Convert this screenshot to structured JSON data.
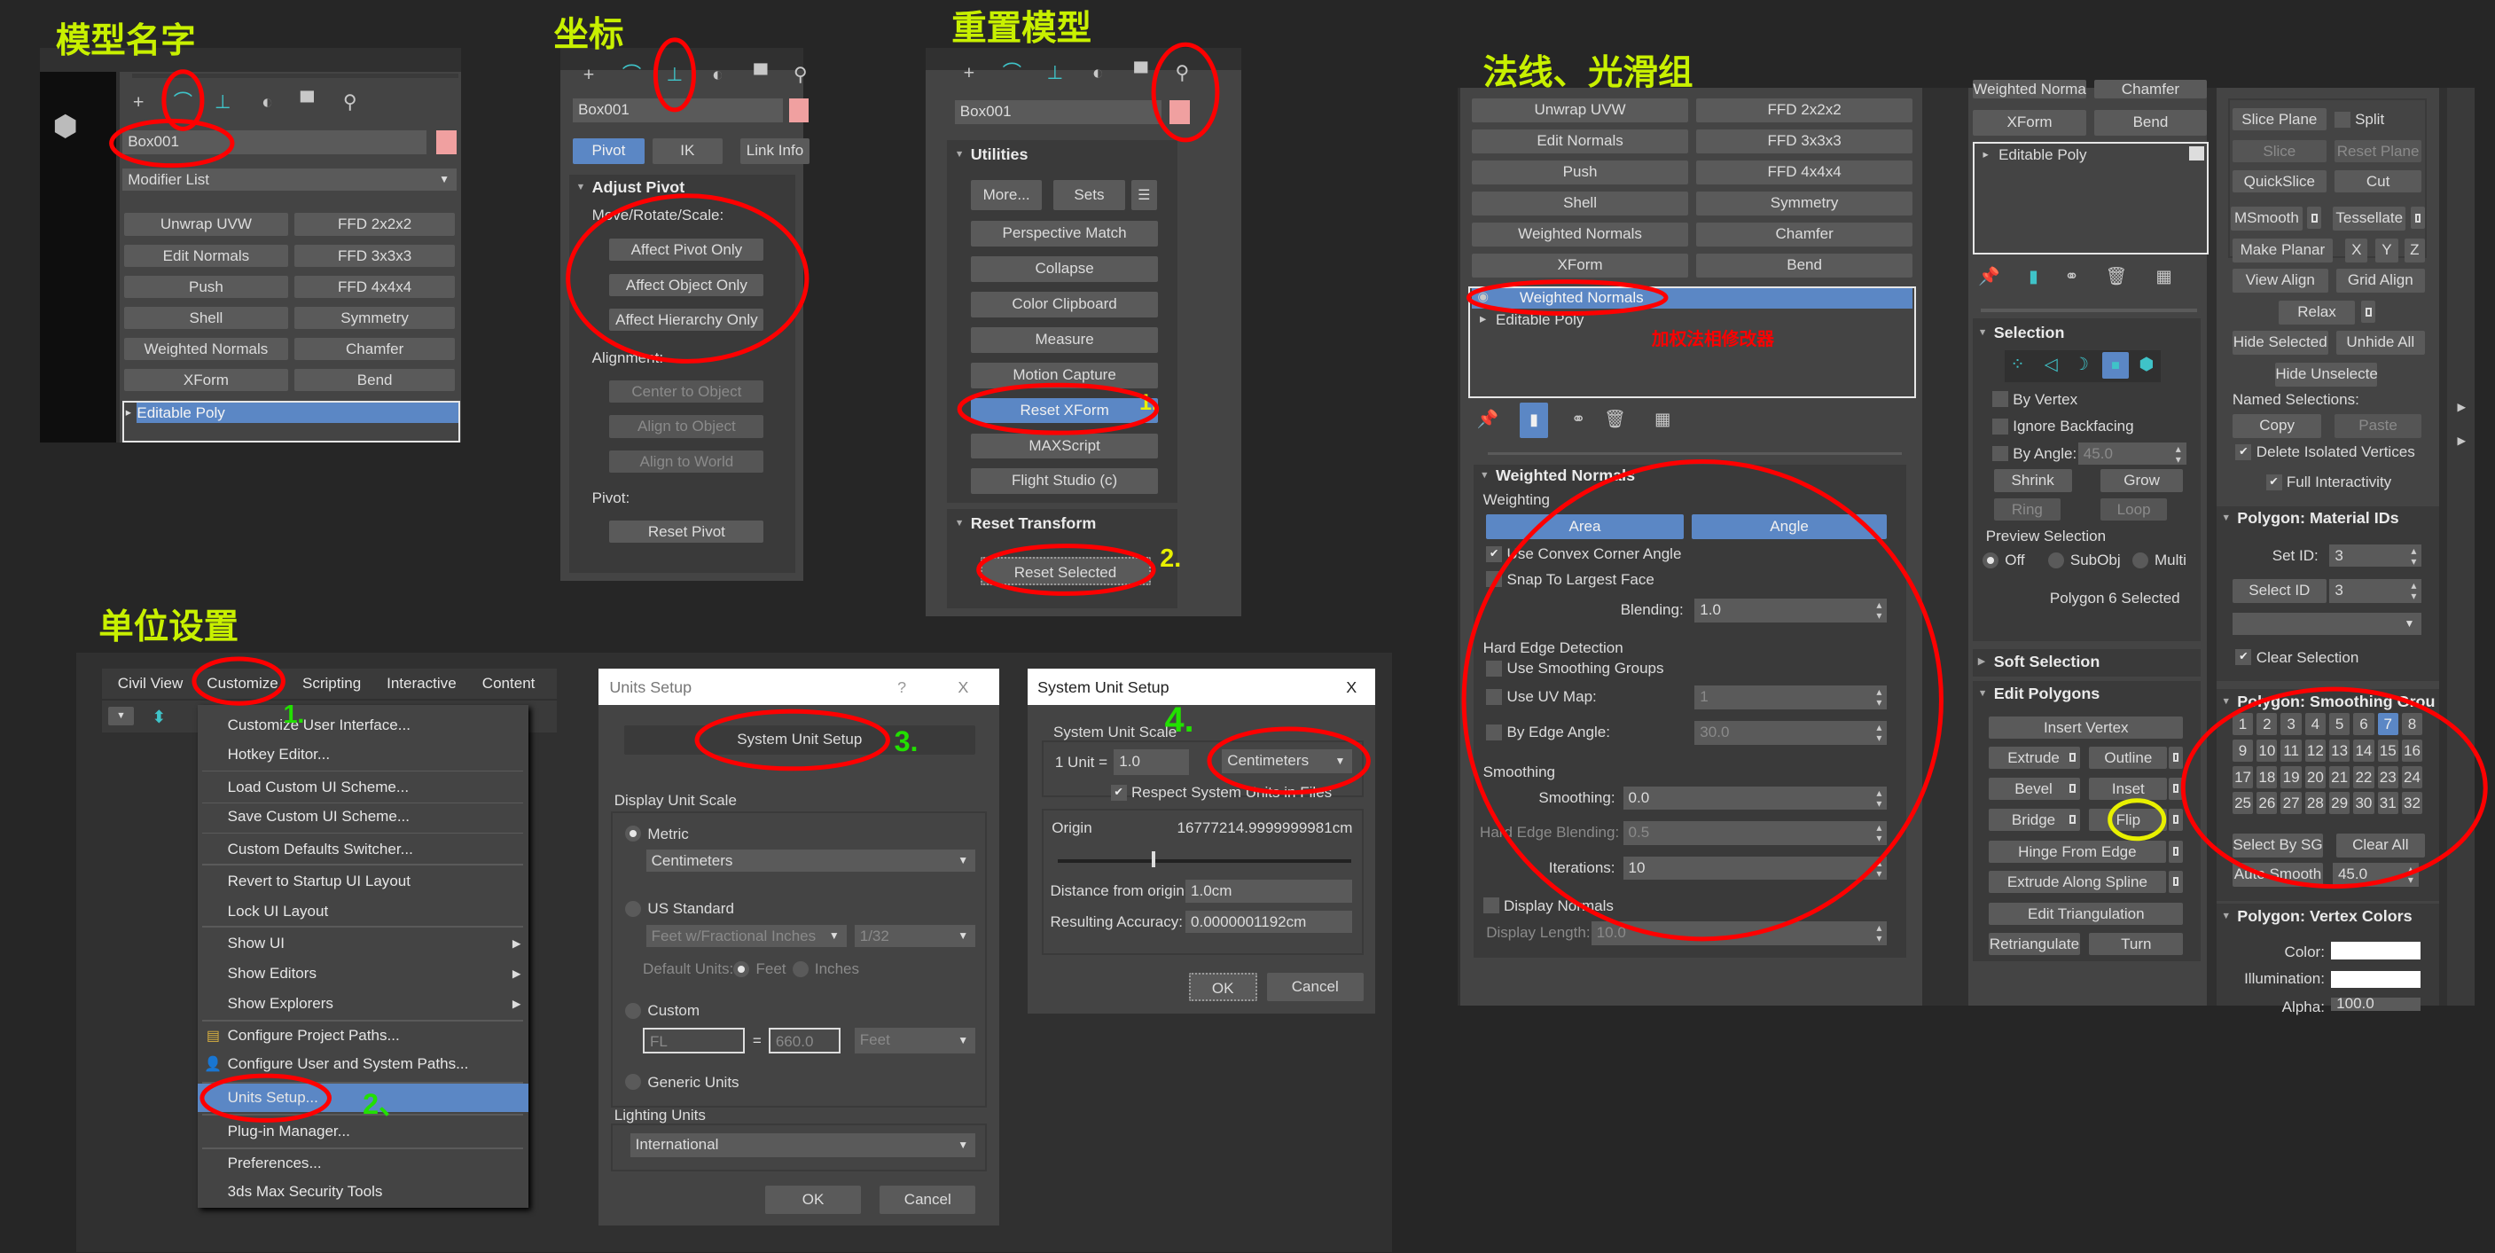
{
  "annotations": {
    "model_name": "模型名字",
    "coordinates": "坐标",
    "reset_model": "重置模型",
    "normals_smoothing": "法线、光滑组",
    "unit_setup": "单位设置",
    "weighted_normals_modifier": "加权法相修改器",
    "step_reset_xform": "1.",
    "step_reset_selected": "2.",
    "step_customize": "1.",
    "step_units_setup": "2、",
    "step_system_unit_setup": "3.",
    "step_centimeters": "4."
  },
  "colors": {
    "title_annotation": "#c8f000",
    "circle_annotation": "#ff0000",
    "step_yellow": "#e8f000",
    "step_green": "#22e000",
    "accent_blue": "#5b87c5",
    "panel_bg": "#444444",
    "button_bg": "#5a5a5a",
    "object_color_swatch": "#f0a0a0"
  },
  "command_tabs": [
    "create-icon",
    "modify-icon",
    "hierarchy-icon",
    "motion-icon",
    "display-icon",
    "utilities-icon"
  ],
  "modify_panel": {
    "object_name": "Box001",
    "modifier_list": "Modifier List",
    "modifiers": [
      "Unwrap UVW",
      "FFD 2x2x2",
      "Edit Normals",
      "FFD 3x3x3",
      "Push",
      "FFD 4x4x4",
      "Shell",
      "Symmetry",
      "Weighted Normals",
      "Chamfer",
      "XForm",
      "Bend"
    ],
    "stack": [
      "Editable Poly"
    ]
  },
  "hierarchy_panel": {
    "object_name": "Box001",
    "tabs": [
      "Pivot",
      "IK",
      "Link Info"
    ],
    "rollout": "Adjust Pivot",
    "move_group": "Move/Rotate/Scale:",
    "move_buttons": [
      "Affect Pivot Only",
      "Affect Object Only",
      "Affect Hierarchy Only"
    ],
    "alignment_group": "Alignment:",
    "alignment_buttons": [
      "Center to Object",
      "Align to Object",
      "Align to World"
    ],
    "pivot_group": "Pivot:",
    "reset_pivot": "Reset Pivot"
  },
  "utilities_panel": {
    "object_name": "Box001",
    "rollout": "Utilities",
    "more": "More...",
    "sets": "Sets",
    "buttons": [
      "Perspective Match",
      "Collapse",
      "Color Clipboard",
      "Measure",
      "Motion Capture",
      "Reset XForm",
      "MAXScript",
      "Flight Studio (c)"
    ],
    "reset_rollout": "Reset Transform",
    "reset_selected": "Reset Selected"
  },
  "normals_panel": {
    "modifiers": [
      "Unwrap UVW",
      "FFD 2x2x2",
      "Edit Normals",
      "FFD 3x3x3",
      "Push",
      "FFD 4x4x4",
      "Shell",
      "Symmetry",
      "Weighted Normals",
      "Chamfer",
      "XForm",
      "Bend"
    ],
    "stack": [
      "Weighted Normals",
      "Editable Poly"
    ],
    "rollout": "Weighted Normals",
    "weighting": "Weighting",
    "area": "Area",
    "angle": "Angle",
    "use_convex": "Use Convex Corner Angle",
    "snap_largest": "Snap To Largest Face",
    "blending_label": "Blending:",
    "blending": "1.0",
    "hard_edge": "Hard Edge Detection",
    "use_sg": "Use Smoothing Groups",
    "use_uv": "Use UV Map:",
    "uv_value": "1",
    "by_edge_angle": "By Edge Angle:",
    "edge_angle": "30.0",
    "smoothing": "Smoothing",
    "smoothing_label": "Smoothing:",
    "smoothing_value": "0.0",
    "hard_edge_blending_label": "Hard Edge Blending:",
    "hard_edge_blending": "0.5",
    "iterations_label": "Iterations:",
    "iterations": "10",
    "display_normals": "Display Normals",
    "display_length_label": "Display Length:",
    "display_length": "10.0"
  },
  "poly_panel": {
    "top_partial": [
      "Weighted Normals",
      "Chamfer"
    ],
    "top_buttons": [
      "XForm",
      "Bend"
    ],
    "stack": [
      "Editable Poly"
    ],
    "selection": "Selection",
    "by_vertex": "By Vertex",
    "ignore_backfacing": "Ignore Backfacing",
    "by_angle": "By Angle:",
    "by_angle_value": "45.0",
    "shrink": "Shrink",
    "grow": "Grow",
    "ring": "Ring",
    "loop": "Loop",
    "preview_selection": "Preview Selection",
    "preview_options": [
      "Off",
      "SubObj",
      "Multi"
    ],
    "status": "Polygon 6 Selected",
    "soft_selection": "Soft Selection",
    "edit_polygons": "Edit Polygons",
    "insert_vertex": "Insert Vertex",
    "extrude": "Extrude",
    "outline": "Outline",
    "bevel": "Bevel",
    "inset": "Inset",
    "bridge": "Bridge",
    "flip": "Flip",
    "hinge": "Hinge From Edge",
    "extrude_spline": "Extrude Along Spline",
    "edit_triangulation": "Edit Triangulation",
    "retriangulate": "Retriangulate",
    "turn": "Turn"
  },
  "geometry_panel": {
    "slice_plane": "Slice Plane",
    "split": "Split",
    "slice": "Slice",
    "reset_plane": "Reset Plane",
    "quickslice": "QuickSlice",
    "cut": "Cut",
    "msmooth": "MSmooth",
    "tessellate": "Tessellate",
    "make_planar": "Make Planar",
    "x": "X",
    "y": "Y",
    "z": "Z",
    "view_align": "View Align",
    "grid_align": "Grid Align",
    "relax": "Relax",
    "hide_selected": "Hide Selected",
    "unhide_all": "Unhide All",
    "hide_unselected": "Hide Unselected",
    "named_selections": "Named Selections:",
    "copy": "Copy",
    "paste": "Paste",
    "delete_isolated": "Delete Isolated Vertices",
    "full_interactivity": "Full Interactivity",
    "material_ids": "Polygon: Material IDs",
    "set_id_label": "Set ID:",
    "set_id": "3",
    "select_id": "Select ID",
    "select_id_value": "3",
    "clear_selection": "Clear Selection",
    "smoothing_groups": "Polygon: Smoothing Grou",
    "groups": [
      "1",
      "2",
      "3",
      "4",
      "5",
      "6",
      "7",
      "8",
      "9",
      "10",
      "11",
      "12",
      "13",
      "14",
      "15",
      "16",
      "17",
      "18",
      "19",
      "20",
      "21",
      "22",
      "23",
      "24",
      "25",
      "26",
      "27",
      "28",
      "29",
      "30",
      "31",
      "32"
    ],
    "active_group": "7",
    "select_by_sg": "Select By SG",
    "clear_all": "Clear All",
    "auto_smooth": "Auto Smooth",
    "auto_smooth_value": "45.0",
    "vertex_colors": "Polygon: Vertex Colors",
    "color_label": "Color:",
    "illumination_label": "Illumination:",
    "alpha_label": "Alpha:",
    "alpha": "100.0"
  },
  "menu_bar": [
    "Civil View",
    "Customize",
    "Scripting",
    "Interactive",
    "Content"
  ],
  "customize_menu": [
    "Customize User Interface...",
    "Hotkey Editor...",
    "Load Custom UI Scheme...",
    "Save Custom UI Scheme...",
    "Custom Defaults Switcher...",
    "Revert to Startup UI Layout",
    "Lock UI Layout",
    "Show UI",
    "Show Editors",
    "Show Explorers",
    "Configure Project Paths...",
    "Configure User and System Paths...",
    "Units Setup...",
    "Plug-in Manager...",
    "Preferences...",
    "3ds Max Security Tools"
  ],
  "units_dialog": {
    "title": "Units Setup",
    "help": "?",
    "close": "X",
    "system_unit_setup": "System Unit Setup",
    "display_unit_scale": "Display Unit Scale",
    "metric": "Metric",
    "metric_unit": "Centimeters",
    "us_standard": "US Standard",
    "us_unit": "Feet w/Fractional Inches",
    "fraction": "1/32",
    "default_units": "Default Units:",
    "feet": "Feet",
    "inches": "Inches",
    "custom": "Custom",
    "custom_name": "FL",
    "equals": "=",
    "custom_value": "660.0",
    "custom_unit": "Feet",
    "generic": "Generic Units",
    "lighting_units": "Lighting Units",
    "lighting_value": "International",
    "ok": "OK",
    "cancel": "Cancel"
  },
  "system_unit_dialog": {
    "title": "System Unit Setup",
    "close": "X",
    "scale_label": "System Unit Scale",
    "unit_eq": "1 Unit =",
    "unit_value": "1.0",
    "unit": "Centimeters",
    "respect": "Respect System Units in Files",
    "origin_label": "Origin",
    "origin_value": "16777214.9999999981cm",
    "distance_label": "Distance from origin:",
    "distance": "1.0cm",
    "accuracy_label": "Resulting Accuracy:",
    "accuracy": "0.0000001192cm",
    "ok": "OK",
    "cancel": "Cancel"
  }
}
